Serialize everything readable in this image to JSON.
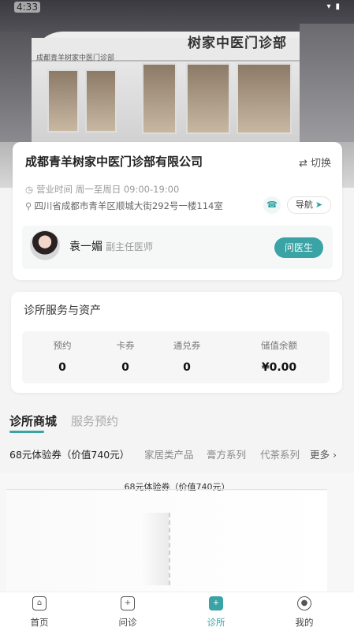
{
  "status_bar": {
    "time": "4:33"
  },
  "hero": {
    "sign_main": "树家中医门诊部",
    "sign_small": "成都青羊树家中医门诊部"
  },
  "clinic": {
    "name": "成都青羊树家中医门诊部有限公司",
    "switch_label": "切换",
    "hours_label": "营业时间",
    "hours": "周一至周日 09:00-19:00",
    "address": "四川省成都市青羊区顺城大街292号一楼114室",
    "nav_label": "导航",
    "icons": {
      "switch": "swap-icon",
      "clock": "clock-icon",
      "location": "location-pin-icon",
      "phone": "phone-icon",
      "navigate": "navigate-arrow-icon"
    }
  },
  "doctor": {
    "name": "袁一媚",
    "title": "副主任医师",
    "ask_label": "问医生"
  },
  "assets": {
    "title": "诊所服务与资产",
    "items": [
      {
        "label": "预约",
        "value": "0"
      },
      {
        "label": "卡券",
        "value": "0"
      },
      {
        "label": "通兑券",
        "value": "0"
      },
      {
        "label": "储值余额",
        "value": "¥0.00"
      }
    ]
  },
  "tabs": [
    {
      "label": "诊所商城",
      "active": true
    },
    {
      "label": "服务预约",
      "active": false
    }
  ],
  "categories": [
    {
      "label": "68元体验券（价值740元）",
      "active": true
    },
    {
      "label": "家居类产品",
      "active": false
    },
    {
      "label": "膏方系列",
      "active": false
    },
    {
      "label": "代茶系列",
      "active": false
    }
  ],
  "more_label": "更多",
  "product": {
    "caption": "68元体验券（价值740元）"
  },
  "bottom_nav": [
    {
      "label": "首页",
      "icon": "home-icon",
      "active": false
    },
    {
      "label": "问诊",
      "icon": "consult-icon",
      "active": false
    },
    {
      "label": "诊所",
      "icon": "clinic-icon",
      "active": true
    },
    {
      "label": "我的",
      "icon": "profile-icon",
      "active": false
    }
  ],
  "colors": {
    "accent": "#3aa3a5"
  }
}
